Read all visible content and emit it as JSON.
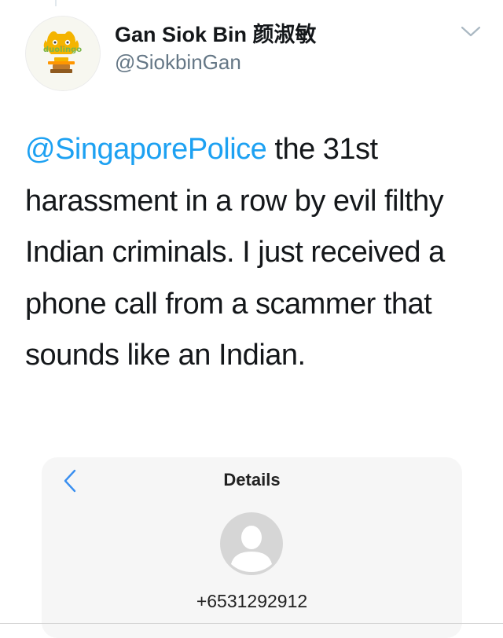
{
  "tweet": {
    "author": {
      "display_name": "Gan Siok Bin 颜淑敏",
      "handle": "@SiokbinGan",
      "avatar_brand_text": "duolingo"
    },
    "text": {
      "mention": "@SingaporePolice",
      "body": " the 31st harassment in a row by evil filthy Indian criminals. I just received a phone call from a scammer that sounds like an Indian."
    },
    "menu_icon": "chevron-down-icon",
    "accent_color": "#1da1f2"
  },
  "attachment": {
    "title": "Details",
    "back_icon": "chevron-left-icon",
    "contact_icon": "person-silhouette-icon",
    "phone_number": "+6531292912"
  }
}
